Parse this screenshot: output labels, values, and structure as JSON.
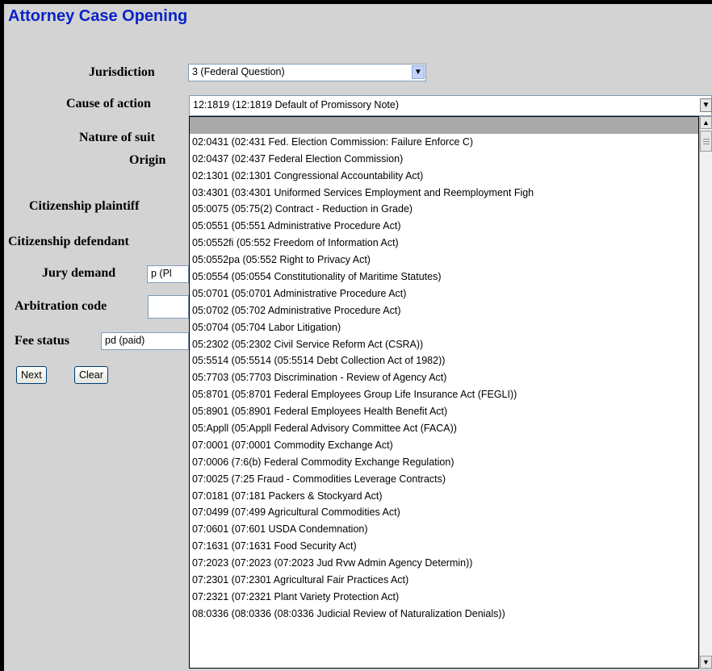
{
  "page": {
    "title": "Attorney Case Opening"
  },
  "form": {
    "jurisdiction_label": "Jurisdiction",
    "jurisdiction_value": "3 (Federal Question)",
    "cause_label": "Cause of action",
    "cause_value": "12:1819 (12:1819 Default of Promissory Note)",
    "nature_label": "Nature of suit",
    "origin_label": "Origin",
    "cit_plaintiff_label": "Citizenship plaintiff",
    "cit_defendant_label": "Citizenship defendant",
    "jury_label": "Jury demand",
    "jury_value": "p (Pl",
    "arb_label": "Arbitration code",
    "arb_value": "",
    "fee_label": "Fee status",
    "fee_value": "pd (paid)"
  },
  "buttons": {
    "next": "Next",
    "clear": "Clear"
  },
  "icons": {
    "dropdown_arrow": "chevron-down-icon",
    "scroll_up": "triangle-up-icon",
    "scroll_down": "chevron-down-icon"
  },
  "dropdown_list": {
    "items": [
      "",
      "02:0431 (02:431 Fed. Election Commission: Failure Enforce C)",
      "02:0437 (02:437 Federal Election Commission)",
      "02:1301 (02:1301 Congressional Accountability Act)",
      "03:4301 (03:4301 Uniformed Services Employment and Reemployment Figh",
      "05:0075 (05:75(2) Contract - Reduction in Grade)",
      "05:0551 (05:551 Administrative Procedure Act)",
      "05:0552fi (05:552 Freedom of Information Act)",
      "05:0552pa (05:552 Right to Privacy Act)",
      "05:0554 (05:0554 Constitutionality of Maritime Statutes)",
      "05:0701 (05:0701 Administrative Procedure Act)",
      "05:0702 (05:702 Administrative Procedure Act)",
      "05:0704 (05:704 Labor Litigation)",
      "05:2302 (05:2302 Civil Service Reform Act (CSRA))",
      "05:5514 (05:5514 (05:5514 Debt Collection Act of 1982))",
      "05:7703 (05:7703 Discrimination - Review of Agency Act)",
      "05:8701 (05:8701 Federal Employees Group Life Insurance Act (FEGLI))",
      "05:8901 (05:8901 Federal Employees Health Benefit Act)",
      "05:Appll (05:Appll Federal Advisory Committee Act (FACA))",
      "07:0001 (07:0001 Commodity Exchange Act)",
      "07:0006 (7:6(b) Federal Commodity Exchange Regulation)",
      "07:0025 (7:25 Fraud - Commodities Leverage Contracts)",
      "07:0181 (07:181 Packers & Stockyard Act)",
      "07:0499 (07:499 Agricultural Commodities Act)",
      "07:0601 (07:601 USDA Condemnation)",
      "07:1631 (07:1631 Food Security Act)",
      "07:2023 (07:2023 (07:2023 Jud Rvw Admin Agency Determin))",
      "07:2301 (07:2301 Agricultural Fair Practices Act)",
      "07:2321 (07:2321 Plant Variety Protection Act)",
      "08:0336 (08:0336 (08:0336 Judicial Review of Naturalization Denials))"
    ]
  }
}
